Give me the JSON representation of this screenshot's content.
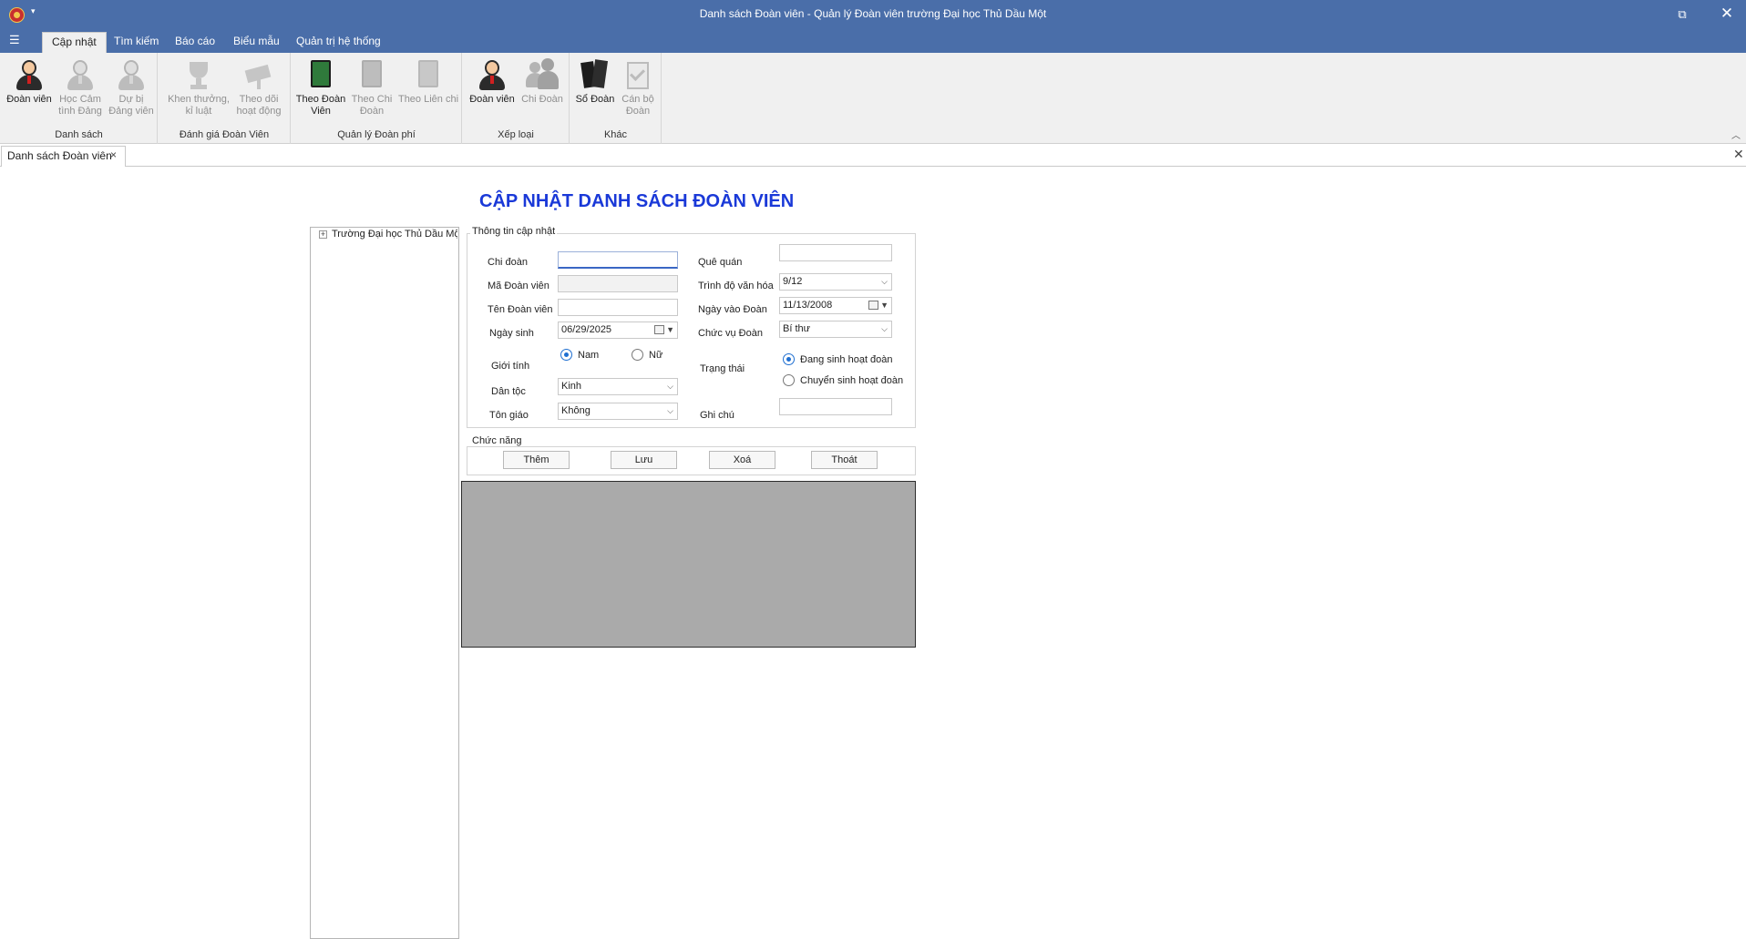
{
  "window": {
    "title": "Danh sách Đoàn viên - Quản lý Đoàn viên trường Đại học Thủ Dầu Một",
    "qat_dropdown": "▾",
    "restore_glyph": "⧉",
    "close_glyph": "✕",
    "file_menu_glyph": "☰"
  },
  "ribbon": {
    "tabs": [
      {
        "label": "Cập nhật"
      },
      {
        "label": "Tìm kiếm"
      },
      {
        "label": "Báo cáo"
      },
      {
        "label": "Biểu mẫu"
      },
      {
        "label": "Quản trị hệ thống"
      }
    ],
    "groups": [
      {
        "label": "Danh sách",
        "buttons": [
          {
            "label1": "Đoàn viên",
            "label2": "",
            "icon": "member-icon"
          },
          {
            "label1": "Học Cảm",
            "label2": "tình Đảng",
            "icon": "party-awareness-icon"
          },
          {
            "label1": "Dự bị",
            "label2": "Đảng viên",
            "icon": "reserve-party-member-icon"
          }
        ]
      },
      {
        "label": "Đánh giá Đoàn Viên",
        "buttons": [
          {
            "label1": "Khen thưởng,",
            "label2": "kỉ luật",
            "icon": "trophy-icon"
          },
          {
            "label1": "Theo dõi",
            "label2": "hoạt động",
            "icon": "camera-icon"
          }
        ]
      },
      {
        "label": "Quản lý Đoàn phí",
        "buttons": [
          {
            "label1": "Theo Đoàn",
            "label2": "Viên",
            "icon": "green-book-icon"
          },
          {
            "label1": "Theo Chi",
            "label2": "Đoàn",
            "icon": "grey-book-icon"
          },
          {
            "label1": "Theo Liên chi",
            "label2": "",
            "icon": "grey-book-icon"
          }
        ]
      },
      {
        "label": "Xếp loại",
        "buttons": [
          {
            "label1": "Đoàn viên",
            "label2": "",
            "icon": "member-icon"
          },
          {
            "label1": "Chi Đoàn",
            "label2": "",
            "icon": "group-icon"
          }
        ]
      },
      {
        "label": "Khác",
        "buttons": [
          {
            "label1": "Sổ Đoàn",
            "label2": "",
            "icon": "books-icon"
          },
          {
            "label1": "Cán bộ",
            "label2": "Đoàn",
            "icon": "clipboard-icon"
          }
        ]
      }
    ],
    "collapse_glyph": "︿"
  },
  "document": {
    "tab_label": "Danh sách Đoàn viên",
    "tab_close": "×",
    "close_all": "✕"
  },
  "form": {
    "title": "CẬP NHẬT DANH SÁCH ĐOÀN VIÊN",
    "tree": {
      "root": "Trường Đại học Thủ Dầu Một",
      "expander": "+"
    },
    "info_legend": "Thông tin cập nhật",
    "labels": {
      "chi_doan": "Chi đoàn",
      "ma_doan_vien": "Mã Đoàn viên",
      "ten_doan_vien": "Tên Đoàn viên",
      "ngay_sinh": "Ngày sinh",
      "gioi_tinh": "Giới tính",
      "dan_toc": "Dân tộc",
      "ton_giao": "Tôn giáo",
      "que_quan": "Quê quán",
      "trinh_do": "Trình độ văn hóa",
      "ngay_vao_doan": "Ngày vào Đoàn",
      "chuc_vu": "Chức vụ Đoàn",
      "trang_thai": "Trạng thái",
      "ghi_chu": "Ghi chú"
    },
    "values": {
      "chi_doan": "",
      "ma_doan_vien": "",
      "ten_doan_vien": "",
      "ngay_sinh": "06/29/2025",
      "dan_toc": "Kinh",
      "ton_giao": "Không",
      "que_quan": "",
      "trinh_do": "9/12",
      "ngay_vao_doan": "11/13/2008",
      "chuc_vu": "Bí thư",
      "ghi_chu": ""
    },
    "gender": {
      "male": "Nam",
      "female": "Nữ",
      "selected": "Nam"
    },
    "status": {
      "active": "Đang sinh hoạt đoàn",
      "transferred": "Chuyển sinh hoạt đoàn",
      "selected": "Đang sinh hoạt đoàn"
    },
    "functions_legend": "Chức năng",
    "buttons": {
      "add": "Thêm",
      "save": "Lưu",
      "delete": "Xoá",
      "exit": "Thoát"
    }
  },
  "colors": {
    "title_bar": "#4a6ea9",
    "heading": "#1a39d8",
    "grid_empty": "#aaaaaa",
    "radio_accent": "#1f6fd1"
  }
}
